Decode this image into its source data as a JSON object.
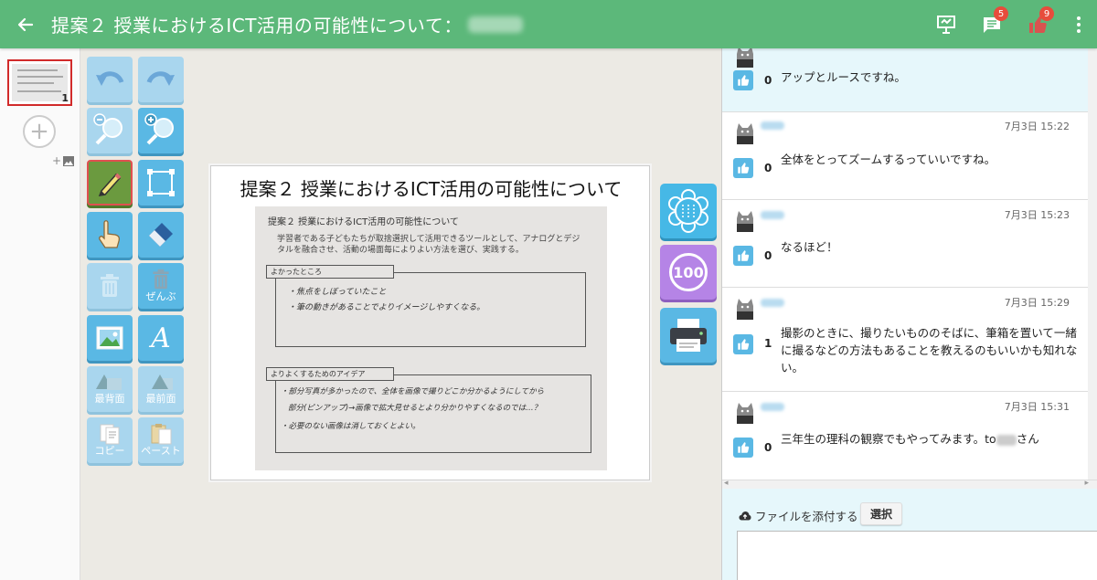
{
  "header": {
    "back_icon": "arrow-left-icon",
    "title": "提案２ 授業におけるICT活用の可能性について：",
    "comment_badge": "5",
    "like_badge": "9"
  },
  "thumbnails": [
    {
      "page": "1",
      "selected": true
    }
  ],
  "tools": {
    "delete_all": "ぜんぶ",
    "send_back": "最背面",
    "bring_front": "最前面",
    "copy": "コピー",
    "paste": "ペースト"
  },
  "slide": {
    "title": "提案２ 授業におけるICT活用の可能性について",
    "photo": {
      "heading": "提案２ 授業におけるICT活用の可能性について",
      "intro": "学習者である子どもたちが取捨選択して活用できるツールとして、アナログとデジタルを融合させ、活動の場面毎によりよい方法を選び、実践する。",
      "good_label": "よかったところ",
      "good_note_1": "・焦点をしぼっていたこと",
      "good_note_2": "・筆の動きがあることでよりイメージしやすくなる。",
      "ideas_label": "よりよくするためのアイデア",
      "idea_note_1": "・部分写真が多かったので、全体を画像で撮りどこか分かるようにしてから",
      "idea_note_2": "部分(ピンアップ)→画像で拡大見せるとより分かりやすくなるのでは…？",
      "idea_note_3": "・必要のない画像は消しておくとよい。"
    }
  },
  "side_buttons": {
    "score": "100"
  },
  "comments": [
    {
      "time": "",
      "likes": "0",
      "text": "アップとルースですね。",
      "highlight": true
    },
    {
      "time": "7月3日 15:22",
      "likes": "0",
      "text": "全体をとってズームするっていいですね。",
      "highlight": false
    },
    {
      "time": "7月3日 15:23",
      "likes": "0",
      "text": "なるほど！",
      "highlight": false
    },
    {
      "time": "7月3日 15:29",
      "likes": "1",
      "text": "撮影のときに、撮りたいもののそばに、筆箱を置いて一緒に撮るなどの方法もあることを教えるのもいいかも知れない。",
      "highlight": false
    },
    {
      "time": "7月3日 15:31",
      "likes": "0",
      "text_before": "三年生の理科の観察でもやってみます。to",
      "text_after": "さん",
      "highlight": false
    }
  ],
  "composer": {
    "attach_label": "ファイルを添付する",
    "select_button": "選択",
    "message_value": ""
  },
  "colors": {
    "header": "#5cb87a",
    "tool_blue": "#5ab8e4",
    "tool_active": "#6b9a3f",
    "score_purple": "#b584e6",
    "badge_red": "#e74c3c"
  }
}
